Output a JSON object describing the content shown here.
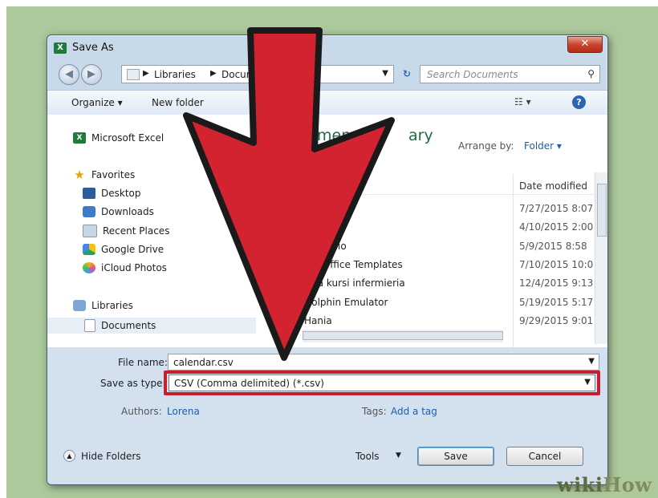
{
  "window": {
    "title": "Save As",
    "app_icon": "X",
    "close_glyph": "✕"
  },
  "address_bar": {
    "crumbs": [
      "Libraries",
      "Documents"
    ]
  },
  "search": {
    "placeholder": "Search Documents"
  },
  "toolbar": {
    "organize": "Organize ▾",
    "new_folder": "New folder",
    "view": "☷ ▾",
    "help": "?"
  },
  "sidebar": {
    "app_item": "Microsoft Excel",
    "favorites_header": "Favorites",
    "favorites": [
      "Desktop",
      "Downloads",
      "Recent Places",
      "Google Drive",
      "iCloud Photos"
    ],
    "libraries_header": "Libraries",
    "libraries": [
      "Documents"
    ]
  },
  "main": {
    "library_title_fragment": "umen",
    "library_title_tail": "ary",
    "arrange_label": "Arrange by:",
    "arrange_value": "Folder ▾",
    "date_column": "Date modified",
    "files": [
      {
        "name": "",
        "date": "7/27/2015 8:07"
      },
      {
        "name": "",
        "date": "4/10/2015 2:00"
      },
      {
        "name": "ia Studio",
        "date": "5/9/2015 8:58"
      },
      {
        "name": "om Office Templates",
        "date": "7/10/2015 10:0"
      },
      {
        "name": "tyra kursi infermieria",
        "date": "12/4/2015 9:13"
      },
      {
        "name": "Dolphin Emulator",
        "date": "5/19/2015 5:17"
      },
      {
        "name": "Hania",
        "date": "9/29/2015 9:01"
      }
    ]
  },
  "form": {
    "file_name_label": "File name:",
    "file_name_value": "calendar.csv",
    "type_label": "Save as type:",
    "type_value": "CSV (Comma delimited) (*.csv)",
    "authors_label": "Authors:",
    "authors_value": "Lorena",
    "tags_label": "Tags:",
    "tags_value": "Add a tag",
    "hide_folders": "Hide Folders",
    "tools": "Tools",
    "save": "Save",
    "cancel": "Cancel"
  },
  "colors": {
    "highlight": "#c6202e",
    "arrow": "#d42330",
    "library_green": "#1e6b45"
  },
  "watermark": {
    "part1": "wiki",
    "part2": "How"
  }
}
